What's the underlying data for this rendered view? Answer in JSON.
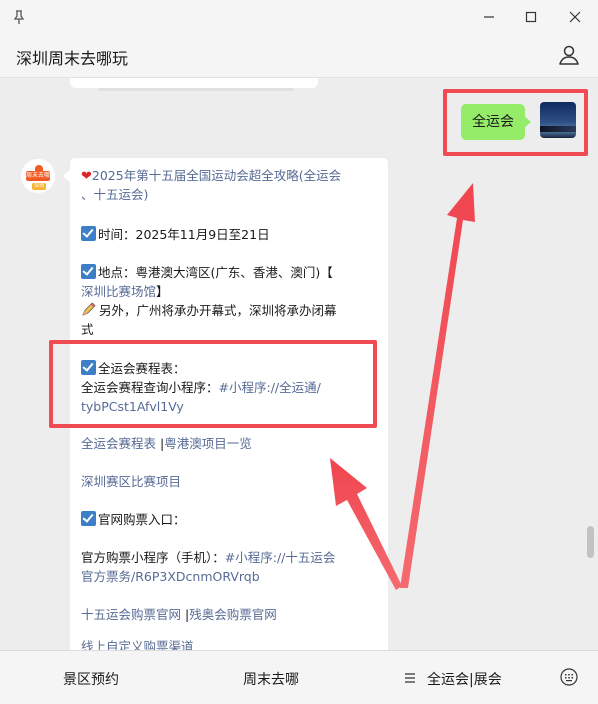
{
  "window": {
    "title": "深圳周末去哪玩"
  },
  "chat": {
    "sent_message": "全运会",
    "bot_avatar_text": "周末去哪",
    "bot_avatar_sub": "深圳",
    "article": {
      "headline_1": "2025年第十五届全国运动会超全攻略(全运会",
      "headline_2": "、十五运会)",
      "time": "时间：2025年11月9日至21日",
      "location_1": "地点：粤港澳大湾区(广东、香港、澳门)【",
      "location_link": "深圳比赛场馆",
      "location_end": "】",
      "note_1": "另外，广州将承办开幕式，深圳将承办闭幕",
      "note_2": "式",
      "schedule_title": "全运会赛程表：",
      "schedule_line_prefix": "全运会赛程查询小程序：",
      "schedule_line_link": "#小程序://全运通/",
      "schedule_line_2": "tybPCst1Afvl1Vy",
      "link_schedule": "全运会赛程表",
      "link_sep": " |",
      "link_gba": "粤港澳项目一览",
      "link_shenzhen": "深圳赛区比赛项目",
      "ticket_title": "官网购票入口：",
      "ticket_line_prefix": "官方购票小程序（手机）：",
      "ticket_line_link": "#小程序://十五运会",
      "ticket_line_2": "官方票务/R6P3XDcnmORVrqb",
      "link_ticket_site": "十五运会购票官网",
      "link_sep2": " |",
      "link_para_site": "残奥会购票官网",
      "cutoff_line": "线上自定义购票渠道"
    }
  },
  "bottom_nav": {
    "item_1": "景区预约",
    "item_2": "周末去哪",
    "item_3": "全运会|展会"
  },
  "colors": {
    "sent_bubble": "#95ec69",
    "link": "#576b95",
    "checkbox": "#3c7ec8",
    "highlight": "#f04a52"
  }
}
